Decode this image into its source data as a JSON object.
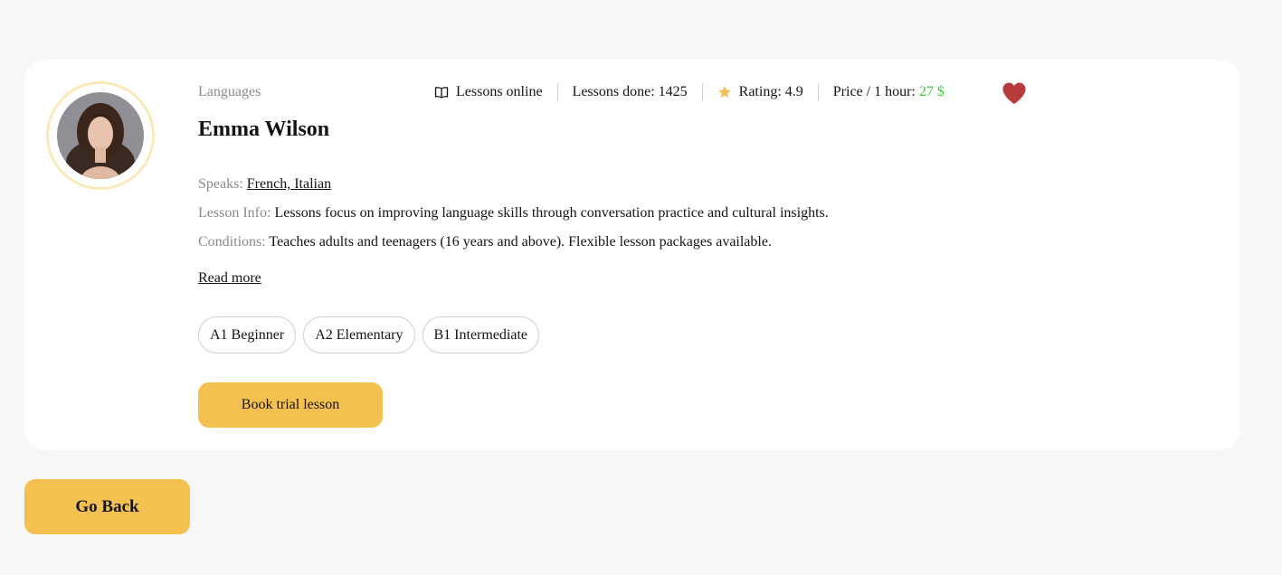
{
  "teacher": {
    "category": "Languages",
    "name": "Emma Wilson",
    "favorited": true
  },
  "stats": {
    "lessons_online": "Lessons online",
    "lessons_done": "Lessons done: 1425",
    "rating": "Rating: 4.9",
    "price_label": "Price / 1 hour:",
    "price_value": "27 $"
  },
  "info": {
    "speaks_label": "Speaks:",
    "speaks_value": "French, Italian",
    "lesson_info_label": "Lesson Info:",
    "lesson_info_value": "Lessons focus on improving language skills through conversation practice and cultural insights.",
    "conditions_label": "Conditions:",
    "conditions_value": "Teaches adults and teenagers (16 years and above). Flexible lesson packages available."
  },
  "read_more": "Read more",
  "levels": [
    "A1 Beginner",
    "A2 Elementary",
    "B1 Intermediate"
  ],
  "buttons": {
    "book": "Book trial lesson",
    "back": "Go Back"
  },
  "colors": {
    "accent": "#f4c150",
    "price": "#38cd3e",
    "heart": "#b83a3a",
    "star": "#f4c150",
    "ring": "#fbe9ba"
  },
  "icons": {
    "book": "open-book-icon",
    "star": "star-icon",
    "heart": "heart-icon"
  }
}
